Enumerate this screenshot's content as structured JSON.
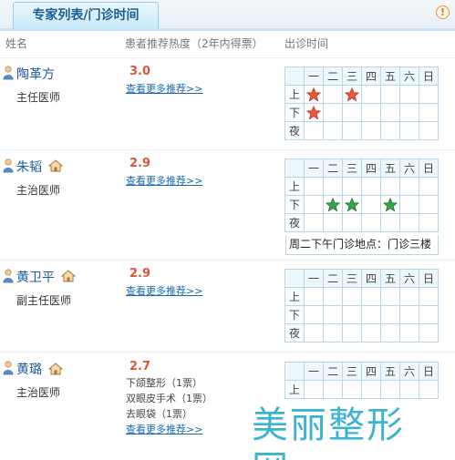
{
  "tab_title": "专家列表/门诊时间",
  "info_icon_glyph": "!",
  "headers": {
    "name": "姓名",
    "rating": "患者推荐热度（2年内得票）",
    "schedule": "出诊时间"
  },
  "days": [
    "一",
    "二",
    "三",
    "四",
    "五",
    "六",
    "日"
  ],
  "periods": [
    "上",
    "下",
    "夜"
  ],
  "colors": {
    "star_red": "#e8573f",
    "star_green": "#3aa24a",
    "link": "#1a68b3",
    "score": "#e0533a"
  },
  "doctors": [
    {
      "name": "陶革方",
      "title": "主任医师",
      "score": "3.0",
      "has_home_icon": false,
      "link": "查看更多推荐>>",
      "slots": {
        "上": [
          "一",
          "三"
        ],
        "下": [
          "一"
        ],
        "夜": []
      },
      "star_color": "red"
    },
    {
      "name": "朱韬",
      "title": "主治医师",
      "score": "2.9",
      "has_home_icon": true,
      "link": "查看更多推荐>>",
      "slots": {
        "上": [],
        "下": [
          "二",
          "三",
          "五"
        ],
        "夜": []
      },
      "star_color": "green",
      "note": "周二下午门诊地点：门诊三楼"
    },
    {
      "name": "黄卫平",
      "title": "副主任医师",
      "score": "2.9",
      "has_home_icon": true,
      "link": "查看更多推荐>>",
      "slots": {
        "上": [],
        "下": [],
        "夜": []
      }
    },
    {
      "name": "黄璐",
      "title": "主治医师",
      "score": "2.7",
      "has_home_icon": true,
      "recommendations": [
        "下颌整形（1票）",
        "双眼皮手术（1票）",
        "去眼袋（1票）"
      ],
      "link": "查看更多推荐>>"
    }
  ],
  "watermark": "美丽整形网"
}
